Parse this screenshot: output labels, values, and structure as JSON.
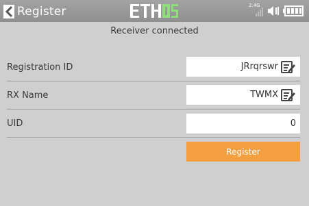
{
  "header": {
    "title": "Register",
    "logo": "ETHOS",
    "logo_colors": {
      "eth": "#ffffff",
      "os": "#8ee07a"
    },
    "status": {
      "rssi_label": "2.4G",
      "icons": [
        "signal-bars-icon",
        "speaker-icon",
        "battery-icon"
      ]
    }
  },
  "notice": "Receiver connected",
  "fields": [
    {
      "label": "Registration ID",
      "value": "JRrqrswr",
      "editable": true
    },
    {
      "label": "RX Name",
      "value": "TWMX",
      "editable": true
    },
    {
      "label": "UID",
      "value": "0",
      "editable": false
    }
  ],
  "register_button": "Register",
  "colors": {
    "background": "#cfcfcf",
    "header": "#999999",
    "accent": "#f4a040"
  }
}
